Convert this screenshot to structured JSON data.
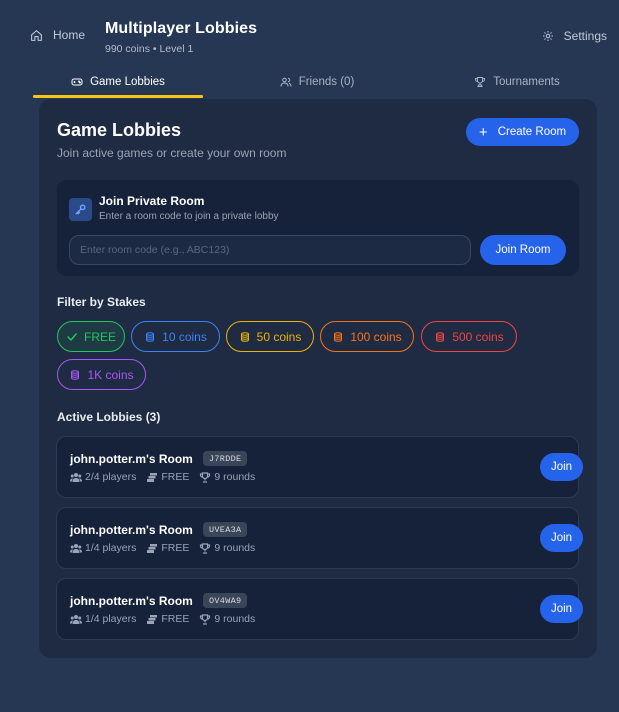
{
  "header": {
    "home_label": "Home",
    "title": "Multiplayer Lobbies",
    "subtitle": "990 coins • Level 1",
    "settings_label": "Settings"
  },
  "tabs": [
    {
      "label": "Game Lobbies",
      "icon": "gamepad-icon",
      "active": true
    },
    {
      "label": "Friends (0)",
      "icon": "users-icon",
      "active": false
    },
    {
      "label": "Tournaments",
      "icon": "trophy-icon",
      "active": false
    }
  ],
  "card": {
    "title": "Game Lobbies",
    "subtitle": "Join active games or create your own room",
    "create_label": "Create Room"
  },
  "private_room": {
    "title": "Join Private Room",
    "subtitle": "Enter a room code to join a private lobby",
    "input_placeholder": "Enter room code (e.g., ABC123)",
    "input_value": "",
    "button_label": "Join Room"
  },
  "filter": {
    "label": "Filter by Stakes",
    "chips": [
      {
        "label": "FREE",
        "icon": "check-icon",
        "color": "#22c55e",
        "selected": true
      },
      {
        "label": "10 coins",
        "icon": "coins-icon",
        "color": "#3b82f6",
        "selected": false
      },
      {
        "label": "50 coins",
        "icon": "coins-icon",
        "color": "#eab308",
        "selected": false
      },
      {
        "label": "100 coins",
        "icon": "coins-icon",
        "color": "#f97316",
        "selected": false
      },
      {
        "label": "500 coins",
        "icon": "coins-icon",
        "color": "#ef4444",
        "selected": false
      },
      {
        "label": "1K coins",
        "icon": "coins-icon",
        "color": "#a855f7",
        "selected": false
      }
    ]
  },
  "lobbies": {
    "label": "Active Lobbies (3)",
    "join_label": "Join",
    "items": [
      {
        "name": "john.potter.m's Room",
        "code": "J7RDDE",
        "players": "2/4 players",
        "stakes": "FREE",
        "rounds": "9 rounds"
      },
      {
        "name": "john.potter.m's Room",
        "code": "UVEA3A",
        "players": "1/4 players",
        "stakes": "FREE",
        "rounds": "9 rounds"
      },
      {
        "name": "john.potter.m's Room",
        "code": "OV4WA9",
        "players": "1/4 players",
        "stakes": "FREE",
        "rounds": "9 rounds"
      }
    ]
  },
  "colors": {
    "background": "#263754",
    "card": "#1f2b42",
    "accent_blue": "#2563eb",
    "tab_underline": "#f5c518"
  }
}
